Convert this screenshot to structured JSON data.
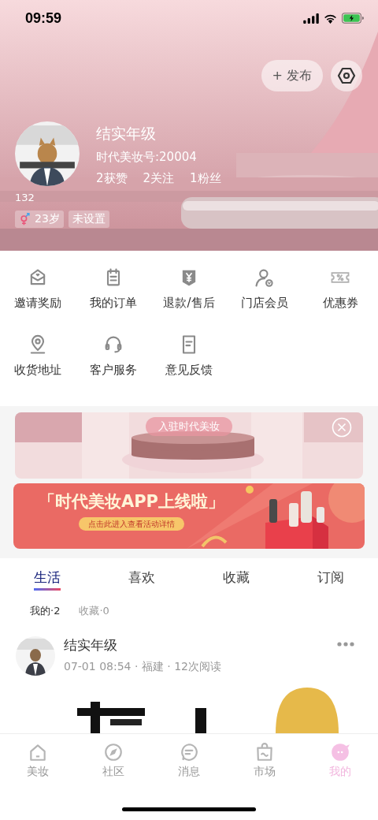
{
  "status_bar": {
    "time": "09:59"
  },
  "header": {
    "publish_button": "+ 发布",
    "name": "结实年级",
    "account_id": "时代美妆号:20004",
    "stats": [
      "2获赞",
      "2关注",
      "1粉丝"
    ],
    "bio": "132",
    "tags": [
      {
        "kind": "gender",
        "label": "23岁"
      },
      {
        "kind": "plain",
        "label": "未设置"
      }
    ]
  },
  "services": [
    {
      "kind": "envelope",
      "label": "邀请奖励"
    },
    {
      "kind": "clipboard",
      "label": "我的订单"
    },
    {
      "kind": "refund",
      "label": "退款/售后"
    },
    {
      "kind": "member",
      "label": "门店会员"
    },
    {
      "kind": "coupon",
      "label": "优惠券"
    },
    {
      "kind": "location",
      "label": "收货地址"
    },
    {
      "kind": "headset",
      "label": "客户服务"
    },
    {
      "kind": "document",
      "label": "意见反馈"
    }
  ],
  "join_banner": {
    "label": "入驻时代美妆"
  },
  "promo_banner": {
    "title": "「时代美妆APP上线啦」",
    "button": "点击此进入查看活动详情"
  },
  "tabs": [
    {
      "label": "生活",
      "selected": true
    },
    {
      "label": "喜欢",
      "selected": false
    },
    {
      "label": "收藏",
      "selected": false
    },
    {
      "label": "订阅",
      "selected": false
    }
  ],
  "subtabs": [
    {
      "label": "我的·2",
      "selected": true
    },
    {
      "label": "收藏·0",
      "selected": false
    }
  ],
  "post": {
    "author": "结实年级",
    "meta": "07-01 08:54 · 福建 · 12次阅读"
  },
  "bottom_nav": [
    {
      "kind": "home",
      "label": "美妆",
      "selected": false
    },
    {
      "kind": "compass",
      "label": "社区",
      "selected": false
    },
    {
      "kind": "chat",
      "label": "消息",
      "selected": false
    },
    {
      "kind": "bag",
      "label": "市场",
      "selected": false
    },
    {
      "kind": "face",
      "label": "我的",
      "selected": true
    }
  ]
}
